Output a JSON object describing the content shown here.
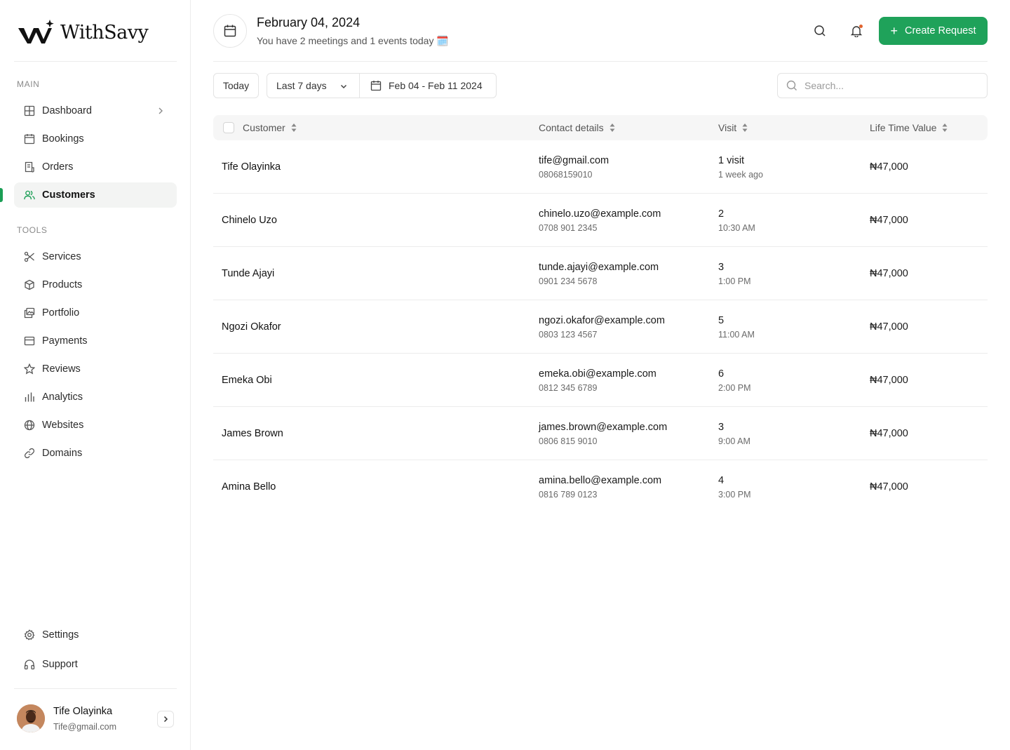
{
  "brand": {
    "name": "WithSavy"
  },
  "sidebar": {
    "main_label": "MAIN",
    "main_items": [
      {
        "label": "Dashboard",
        "icon": "grid-icon"
      },
      {
        "label": "Bookings",
        "icon": "calendar-icon"
      },
      {
        "label": "Orders",
        "icon": "receipt-icon"
      },
      {
        "label": "Customers",
        "icon": "users-icon",
        "active": true
      }
    ],
    "tools_label": "TOOLS",
    "tools_items": [
      {
        "label": "Services",
        "icon": "scissors-icon"
      },
      {
        "label": "Products",
        "icon": "box-icon"
      },
      {
        "label": "Portfolio",
        "icon": "images-icon"
      },
      {
        "label": "Payments",
        "icon": "card-icon"
      },
      {
        "label": "Reviews",
        "icon": "star-icon"
      },
      {
        "label": "Analytics",
        "icon": "bar-chart-icon"
      },
      {
        "label": "Websites",
        "icon": "globe-icon"
      },
      {
        "label": "Domains",
        "icon": "link-icon"
      }
    ],
    "bottom_items": [
      {
        "label": "Settings",
        "icon": "gear-icon"
      },
      {
        "label": "Support",
        "icon": "headphones-icon"
      }
    ],
    "user": {
      "name": "Tife Olayinka",
      "email": "Tife@gmail.com"
    }
  },
  "header": {
    "date": "February 04, 2024",
    "subtitle": "You have 2 meetings and 1 events today 🗓️",
    "create_label": "Create Request"
  },
  "filters": {
    "today_label": "Today",
    "range_label": "Last 7 days",
    "date_range": "Feb 04 - Feb 11 2024",
    "search_placeholder": "Search..."
  },
  "table": {
    "columns": [
      "Customer",
      "Contact details",
      "Visit",
      "Life Time Value"
    ],
    "rows": [
      {
        "name": "Tife Olayinka",
        "email": "tife@gmail.com",
        "phone": "08068159010",
        "visit": "1 visit",
        "when": "1 week ago",
        "ltv": "₦47,000"
      },
      {
        "name": "Chinelo Uzo",
        "email": "chinelo.uzo@example.com",
        "phone": "0708 901 2345",
        "visit": "2",
        "when": "10:30 AM",
        "ltv": "₦47,000"
      },
      {
        "name": "Tunde Ajayi",
        "email": "tunde.ajayi@example.com",
        "phone": "0901 234 5678",
        "visit": "3",
        "when": "1:00 PM",
        "ltv": "₦47,000"
      },
      {
        "name": "Ngozi Okafor",
        "email": "ngozi.okafor@example.com",
        "phone": "0803 123 4567",
        "visit": "5",
        "when": "11:00 AM",
        "ltv": "₦47,000"
      },
      {
        "name": "Emeka Obi",
        "email": "emeka.obi@example.com",
        "phone": "0812 345 6789",
        "visit": "6",
        "when": "2:00 PM",
        "ltv": "₦47,000"
      },
      {
        "name": "James Brown",
        "email": "james.brown@example.com",
        "phone": "0806 815 9010",
        "visit": "3",
        "when": "9:00 AM",
        "ltv": "₦47,000"
      },
      {
        "name": "Amina Bello",
        "email": "amina.bello@example.com",
        "phone": "0816 789 0123",
        "visit": "4",
        "when": "3:00 PM",
        "ltv": "₦47,000"
      }
    ]
  },
  "colors": {
    "accent": "#1fa25a",
    "notification": "#e0632e"
  }
}
